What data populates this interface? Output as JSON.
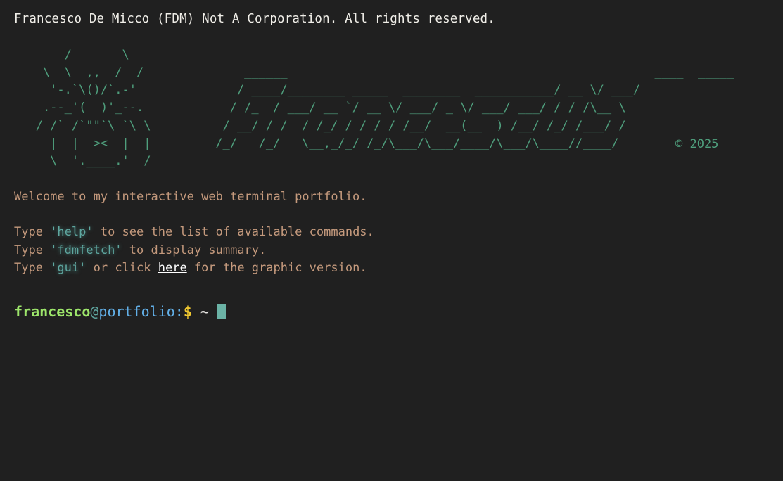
{
  "header": {
    "copyright_line": "Francesco De Micco (FDM) Not A Corporation. All rights reserved."
  },
  "ascii_art": {
    "left_lines": "       /       \\\n    \\  \\  ,,  /  /\n     '-.`\\()/`.-'\n    .--_'(  )'_--.\n   / /` /`\"\"`\\ `\\ \\\n     |  |  ><  |  |\n     \\  '.____.'  /",
    "right_lines": "     ______                                                   ____  _____\n    / ____/________ _____  ________  ___________/ __ \\/ ___/\n   / /_  / ___/ __ `/ __ \\/ ___/ _ \\/ ___/ ___/ / / /\\__ \\\n  / __/ / /  / /_/ / / / / /__/  __(__  ) /__/ /_/ /___/ /\n /_/   /_/   \\__,_/_/ /_/\\___/\\___/____/\\___/\\____//____/",
    "year_label": "© 2025"
  },
  "intro": {
    "welcome": "Welcome to my interactive web terminal portfolio.",
    "type_word": "Type ",
    "help_cmd": "'help'",
    "help_suffix": " to see the list of available commands.",
    "fetch_cmd": "'fdmfetch'",
    "fetch_suffix": " to display summary.",
    "gui_cmd": "'gui'",
    "gui_middle": " or click ",
    "gui_link": "here",
    "gui_suffix": " for the graphic version."
  },
  "prompt": {
    "user": "francesco",
    "at": "@",
    "host": "portfolio",
    "colon": ":",
    "dollar": "$",
    "path": " ~"
  },
  "colors": {
    "background": "#202020",
    "ascii_green": "#4f9f7d",
    "intro_orange": "#c59a7d",
    "command_teal": "#5fa7a0",
    "prompt_user": "#9de66b",
    "prompt_host": "#62b0e8",
    "prompt_dollar": "#f0c830",
    "cursor": "#6bb3a6"
  }
}
